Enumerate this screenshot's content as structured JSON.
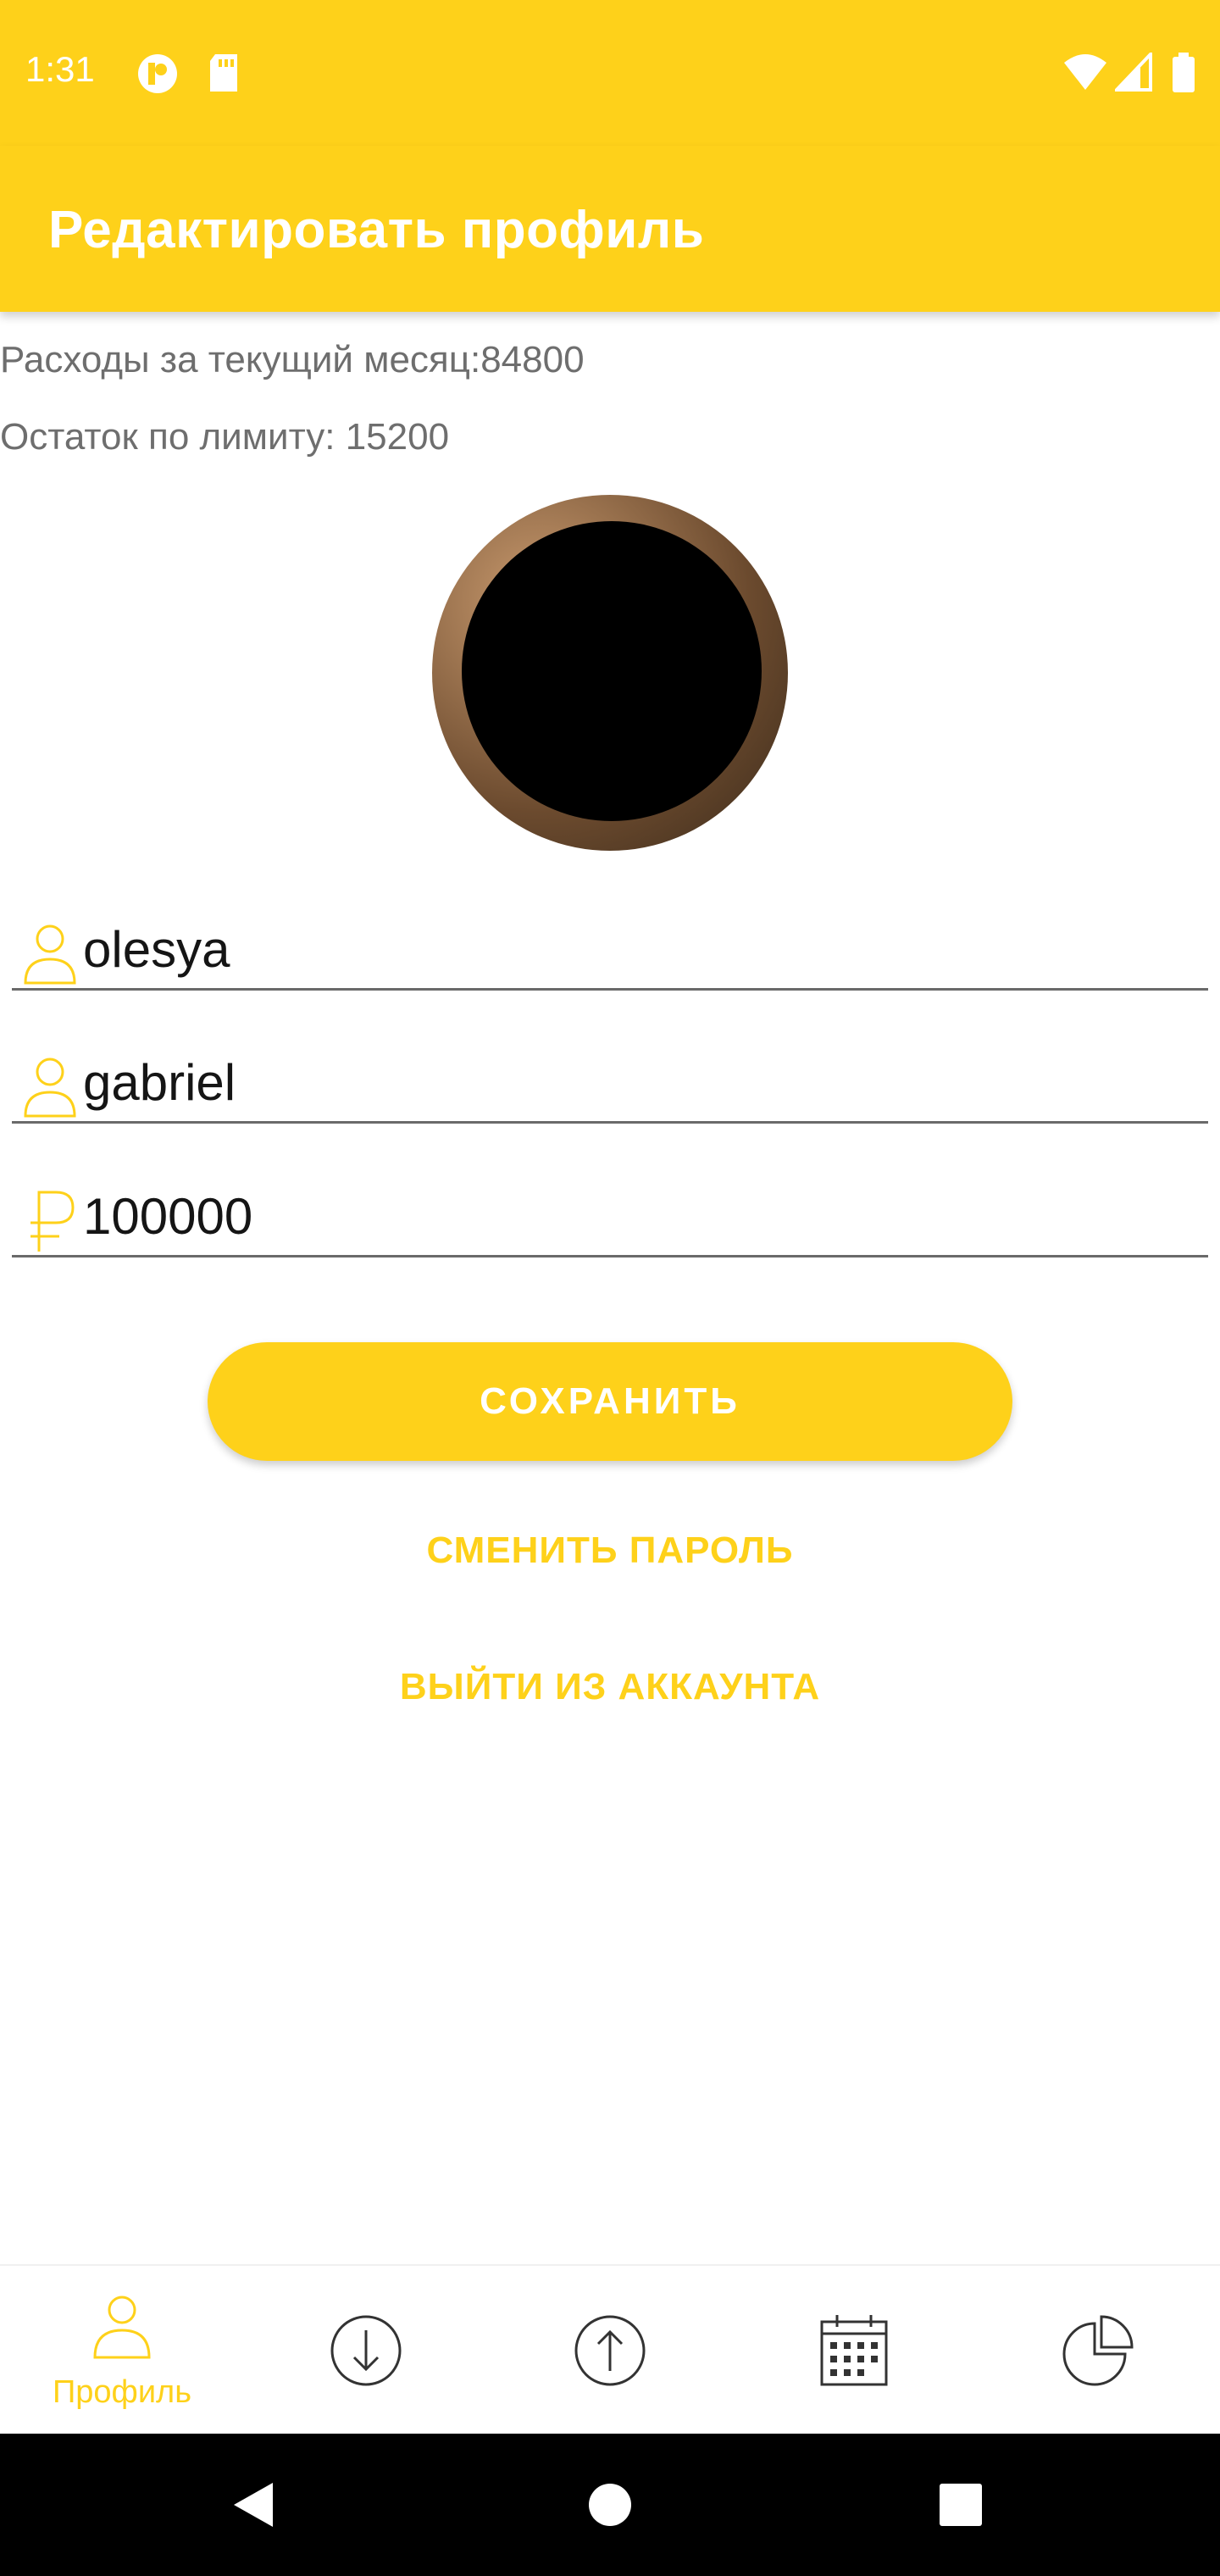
{
  "status_bar": {
    "time": "1:31"
  },
  "app_bar": {
    "title": "Редактировать профиль"
  },
  "summary": {
    "expenses_label": "Расходы за текущий месяц:",
    "expenses_value": "84800",
    "limit_label": "Остаток по лимиту:",
    "limit_value": "15200"
  },
  "form": {
    "first_name": "olesya",
    "last_name": "gabriel",
    "limit": "100000"
  },
  "actions": {
    "save_label": "СОХРАНИТЬ",
    "change_password_label": "СМЕНИТЬ ПАРОЛЬ",
    "logout_label": "ВЫЙТИ ИЗ АККАУНТА"
  },
  "bottom_nav": {
    "items": [
      {
        "icon": "person-icon",
        "label": "Профиль",
        "active": true
      },
      {
        "icon": "arrow-down-circle-icon",
        "label": "",
        "active": false
      },
      {
        "icon": "arrow-up-circle-icon",
        "label": "",
        "active": false
      },
      {
        "icon": "calendar-icon",
        "label": "",
        "active": false
      },
      {
        "icon": "pie-chart-icon",
        "label": "",
        "active": false
      }
    ]
  },
  "colors": {
    "accent": "#FED11A",
    "text_secondary": "#6e6e6e"
  }
}
